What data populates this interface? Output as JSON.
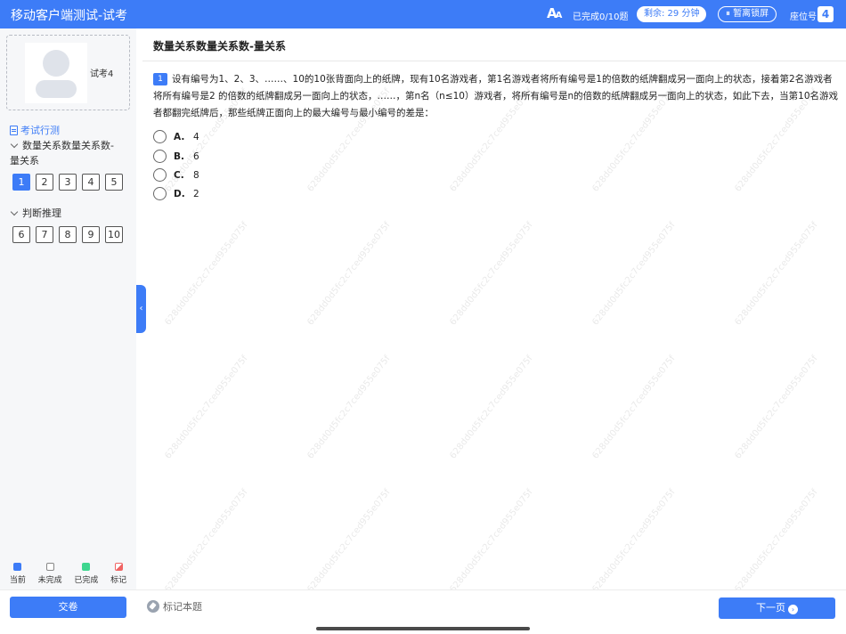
{
  "header": {
    "title": "移动客户端测试-试考",
    "font_size_icon": "font-size-icon",
    "font_icon_text": "AA",
    "progress": "已完成0/10题",
    "timer": "剩余: 29 分钟",
    "pause_label": "⏸ 暂离锁屏",
    "seat_label": "座位号",
    "seat_number": "4"
  },
  "sidebar": {
    "profile_name": "试考4",
    "exam_name": "考试行测",
    "sections": [
      {
        "label": "数量关系数量关系数-",
        "label2": "量关系",
        "questions": [
          "1",
          "2",
          "3",
          "4",
          "5"
        ]
      },
      {
        "label": "判断推理",
        "questions": [
          "6",
          "7",
          "8",
          "9",
          "10"
        ]
      }
    ],
    "legend": [
      "当前",
      "未完成",
      "已完成",
      "标记"
    ]
  },
  "question": {
    "section_title": "数量关系数量关系数-量关系",
    "number": "1",
    "text": "设有编号为1、2、3、……、10的10张背面向上的纸牌，现有10名游戏者，第1名游戏者将所有编号是1的倍数的纸牌翻成另一面向上的状态，接着第2名游戏者将所有编号是2 的倍数的纸牌翻成另一面向上的状态，……，第n名（n≤10）游戏者，将所有编号是n的倍数的纸牌翻成另一面向上的状态，如此下去，当第10名游戏者都翻完纸牌后，那些纸牌正面向上的最大编号与最小编号的差是：",
    "options": [
      {
        "letter": "A.",
        "value": "4"
      },
      {
        "letter": "B.",
        "value": "6"
      },
      {
        "letter": "C.",
        "value": "8"
      },
      {
        "letter": "D.",
        "value": "2"
      }
    ]
  },
  "watermark": "628dd0d5fc2c7ced955e075f",
  "footer": {
    "submit": "交卷",
    "mark": "标记本题",
    "next": "下一页"
  },
  "colors": {
    "accent": "#3d7cf7",
    "done": "#3ed68f",
    "marked": "#f06464"
  }
}
